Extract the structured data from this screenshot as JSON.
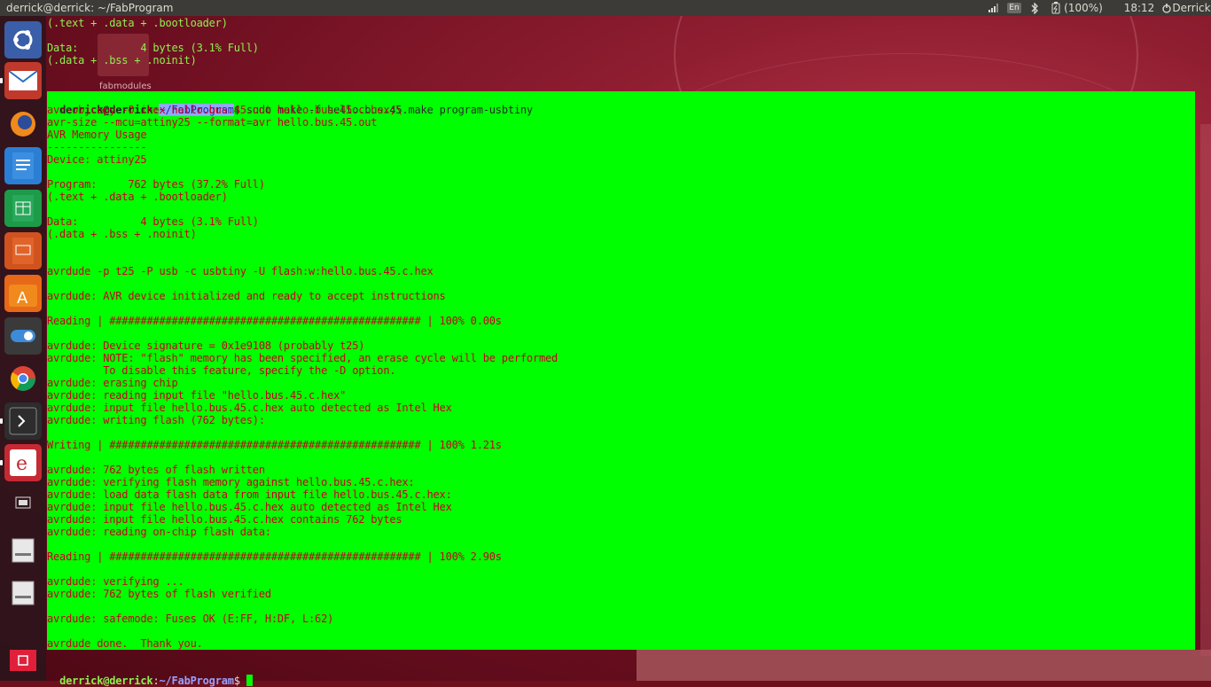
{
  "window": {
    "title": "derrick@derrick: ~/FabProgram"
  },
  "topbar": {
    "keyboard_layout": "En",
    "battery_text": "(100%)",
    "clock": "18:12",
    "user": "Derrick",
    "icons": [
      "network-signal-icon",
      "keyboard-icon",
      "bluetooth-icon",
      "battery-icon",
      "power-icon"
    ]
  },
  "launcher": {
    "items": [
      {
        "name": "ubuntu-dash-icon",
        "color": "#3a5fa8"
      },
      {
        "name": "mail-icon",
        "color": "#c0392b"
      },
      {
        "name": "firefox-icon",
        "color": "#e8681a"
      },
      {
        "name": "writer-icon",
        "color": "#2a7fd4"
      },
      {
        "name": "calc-icon",
        "color": "#1e9b48"
      },
      {
        "name": "impress-icon",
        "color": "#d0531f"
      },
      {
        "name": "software-center-icon",
        "color": "#e8681a"
      },
      {
        "name": "settings-toggle-icon",
        "color": "#3a3a3a"
      },
      {
        "name": "chrome-icon",
        "color": "#dddddd"
      },
      {
        "name": "terminal-icon",
        "color": "#2d2d2d"
      },
      {
        "name": "app-e-icon",
        "color": "#c52a34"
      },
      {
        "name": "workspace-switcher-icon",
        "color": "#333333"
      },
      {
        "name": "drive-icon",
        "color": "#cccccc"
      },
      {
        "name": "drive-icon-2",
        "color": "#cccccc"
      },
      {
        "name": "trash-icon",
        "color": "#c0392b"
      }
    ]
  },
  "desktop": {
    "folder_label": "fabmodules"
  },
  "background_lines": [
    "(.text + .data + .bootloader)",
    "",
    "Data:          4 bytes (3.1% Full)",
    "(.data + .bss + .noinit)"
  ],
  "terminal": {
    "prompt_user": "derrick@derrick",
    "prompt_path": "~/FabProgram",
    "command": "$ sudo make -f hello.bus.45.make program-usbtiny",
    "output_lines": [
      "avr-objcopy -O ihex hello.bus.45.out hello.bus.45.c.hex;\\",
      "avr-size --mcu=attiny25 --format=avr hello.bus.45.out",
      "AVR Memory Usage",
      "----------------",
      "Device: attiny25",
      "",
      "Program:     762 bytes (37.2% Full)",
      "(.text + .data + .bootloader)",
      "",
      "Data:          4 bytes (3.1% Full)",
      "(.data + .bss + .noinit)",
      "",
      "",
      "avrdude -p t25 -P usb -c usbtiny -U flash:w:hello.bus.45.c.hex",
      "",
      "avrdude: AVR device initialized and ready to accept instructions",
      "",
      "Reading | ################################################## | 100% 0.00s",
      "",
      "avrdude: Device signature = 0x1e9108 (probably t25)",
      "avrdude: NOTE: \"flash\" memory has been specified, an erase cycle will be performed",
      "         To disable this feature, specify the -D option.",
      "avrdude: erasing chip",
      "avrdude: reading input file \"hello.bus.45.c.hex\"",
      "avrdude: input file hello.bus.45.c.hex auto detected as Intel Hex",
      "avrdude: writing flash (762 bytes):",
      "",
      "Writing | ################################################## | 100% 1.21s",
      "",
      "avrdude: 762 bytes of flash written",
      "avrdude: verifying flash memory against hello.bus.45.c.hex:",
      "avrdude: load data flash data from input file hello.bus.45.c.hex:",
      "avrdude: input file hello.bus.45.c.hex auto detected as Intel Hex",
      "avrdude: input file hello.bus.45.c.hex contains 762 bytes",
      "avrdude: reading on-chip flash data:",
      "",
      "Reading | ################################################## | 100% 2.90s",
      "",
      "avrdude: verifying ...",
      "avrdude: 762 bytes of flash verified",
      "",
      "avrdude: safemode: Fuses OK (E:FF, H:DF, L:62)",
      "",
      "avrdude done.  Thank you."
    ],
    "final_prompt_user": "derrick@derrick",
    "final_prompt_path": "~/FabProgram",
    "final_prompt_suffix": "$ "
  }
}
